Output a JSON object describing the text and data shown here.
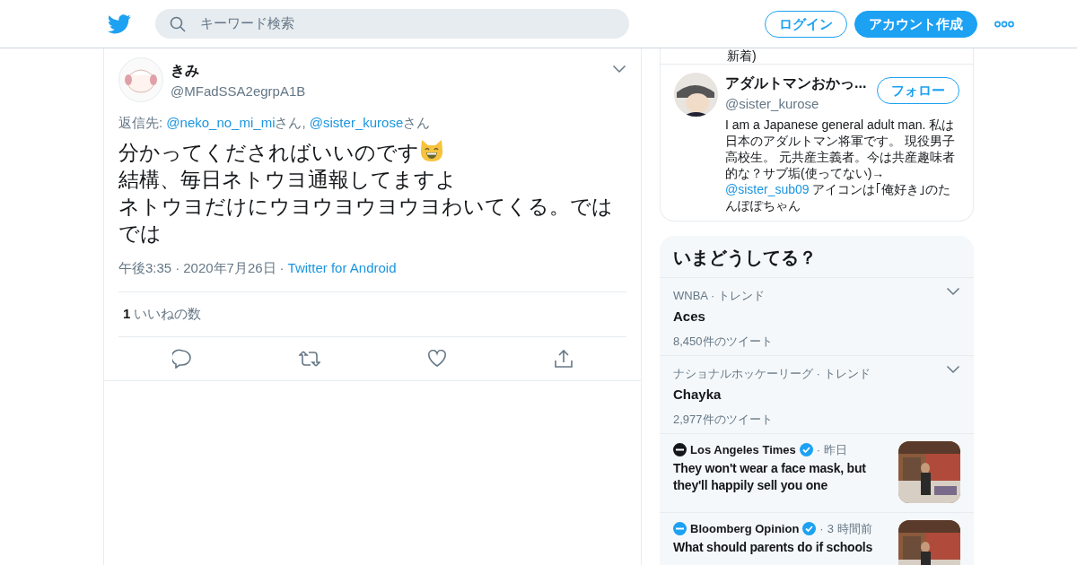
{
  "header": {
    "search": {
      "placeholder": "キーワード検索"
    },
    "buttons": [
      {
        "label": "ログイン",
        "kind": "outline"
      },
      {
        "label": "アカウント作成",
        "kind": "filled"
      }
    ]
  },
  "tweet": {
    "name": "きみ",
    "handle": "@MFadSSA2egrpA1B",
    "reply_to": {
      "prefix": "返信先: ",
      "mentions": [
        {
          "handle": "@neko_no_mi_mi",
          "suffix": "さん"
        },
        {
          "handle": "@sister_kurose",
          "suffix": "さん"
        }
      ],
      "separator": ", "
    },
    "lines": [
      {
        "text": "分かってくださればいいのです",
        "emoji": true
      },
      {
        "text": "結構、毎日ネトウヨ通報してますよ"
      },
      {
        "text": "ネトウヨだけにウヨウヨウヨウヨわいてくる。ではでは"
      }
    ],
    "separator": "·",
    "time": "午後3:35",
    "date": "2020年7月26日",
    "source": "Twitter for Android",
    "likes_count": "1",
    "likes_label": "いいねの数"
  },
  "follow_card": {
    "cut_text": "新着)",
    "user": {
      "name": "アダルトマンおかっ...",
      "handle": "@sister_kurose",
      "follow_label": "フォロー",
      "bio": [
        {
          "kind": "text",
          "text": "I am a Japanese general adult man. 私は日本のアダルトマン将軍です。 現役男子高校生。 元共産主義者。今は共産趣味者的な？サブ垢(使ってない)→ "
        },
        {
          "kind": "link",
          "text": "@sister_sub09"
        },
        {
          "kind": "text",
          "text": " アイコンは｢俺好き｣のたんぽぽちゃん"
        }
      ]
    }
  },
  "trends": {
    "title": "いまどうしてる？",
    "items": [
      {
        "kind": "trend",
        "context": "WNBA · トレンド",
        "name": "Aces",
        "count": "8,450件のツイート"
      },
      {
        "kind": "trend",
        "context": "ナショナルホッケーリーグ · トレンド",
        "name": "Chayka",
        "count": "2,977件のツイート"
      },
      {
        "kind": "news",
        "source": "Los Angeles Times",
        "separator": "·",
        "time": "昨日",
        "headline": "They won't wear a face mask, but they'll happily sell you one",
        "color": "#14171a"
      },
      {
        "kind": "news",
        "source": "Bloomberg Opinion",
        "separator": "·",
        "time": "3 時間前",
        "headline": "What should parents do if schools",
        "color": "#1da1f2"
      }
    ]
  }
}
